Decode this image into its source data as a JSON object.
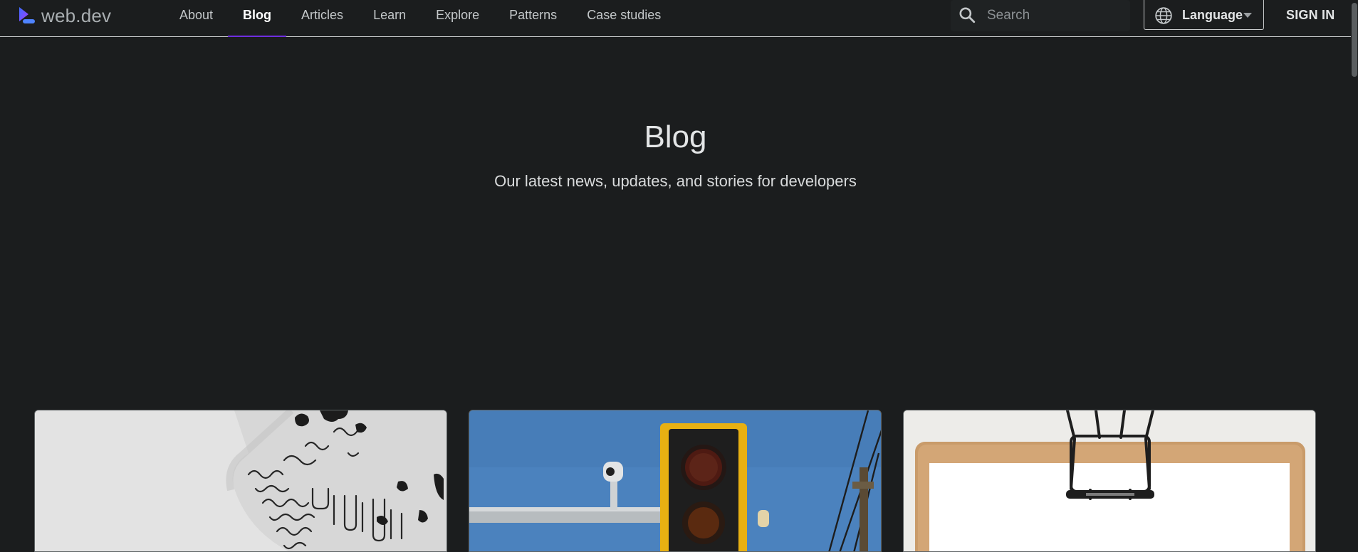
{
  "header": {
    "logo_text": "web.dev",
    "nav": [
      {
        "label": "About",
        "active": false
      },
      {
        "label": "Blog",
        "active": true
      },
      {
        "label": "Articles",
        "active": false
      },
      {
        "label": "Learn",
        "active": false
      },
      {
        "label": "Explore",
        "active": false
      },
      {
        "label": "Patterns",
        "active": false
      },
      {
        "label": "Case studies",
        "active": false
      }
    ],
    "search_placeholder": "Search",
    "language_label": "Language",
    "signin_label": "SIGN IN",
    "accent_color": "#6f2ee0"
  },
  "hero": {
    "title": "Blog",
    "subtitle": "Our latest news, updates, and stories for developers"
  },
  "cards": [
    {
      "image": "white-maze-puzzle-pieces"
    },
    {
      "image": "traffic-light-with-camera"
    },
    {
      "image": "clipboard-with-blank-paper"
    }
  ],
  "icons": {
    "logo": "webdev-logo-icon",
    "search": "search-icon",
    "language": "globe-icon",
    "dropdown": "caret-down-icon"
  }
}
